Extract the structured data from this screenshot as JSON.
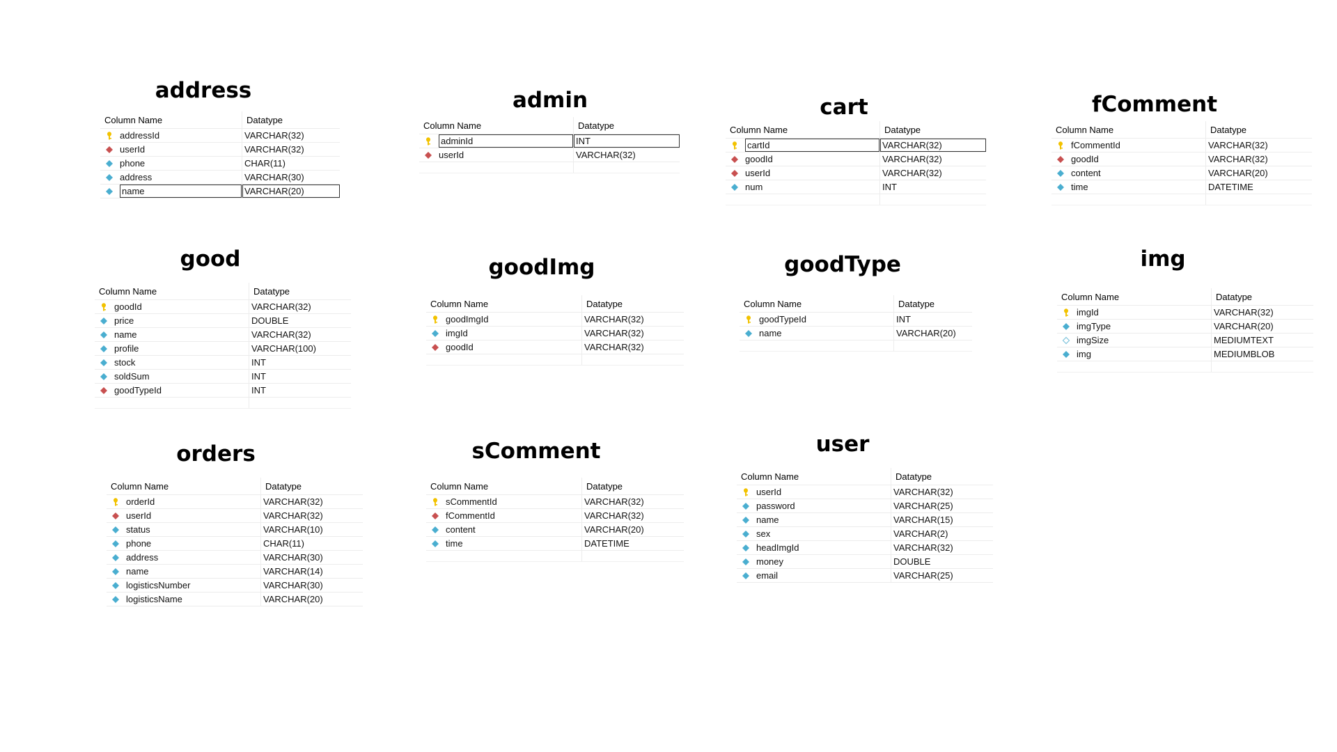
{
  "header": {
    "col_name": "Column Name",
    "col_type": "Datatype"
  },
  "colors": {
    "pk": "#f2c200",
    "fk": "#c85050",
    "col": "#4aaed0",
    "colOutline": "#7fc4dc"
  },
  "tables": [
    {
      "name": "address",
      "columns": [
        {
          "name": "addressId",
          "type": "VARCHAR(32)",
          "key": "pk"
        },
        {
          "name": "userId",
          "type": "VARCHAR(32)",
          "key": "fk"
        },
        {
          "name": "phone",
          "type": "CHAR(11)",
          "key": "col"
        },
        {
          "name": "address",
          "type": "VARCHAR(30)",
          "key": "col"
        },
        {
          "name": "name",
          "type": "VARCHAR(20)",
          "key": "col",
          "selected": true
        }
      ]
    },
    {
      "name": "admin",
      "columns": [
        {
          "name": "adminId",
          "type": "INT",
          "key": "pk",
          "selected": true
        },
        {
          "name": "userId",
          "type": "VARCHAR(32)",
          "key": "fk"
        }
      ]
    },
    {
      "name": "cart",
      "columns": [
        {
          "name": "cartId",
          "type": "VARCHAR(32)",
          "key": "pk",
          "selected": true
        },
        {
          "name": "goodId",
          "type": "VARCHAR(32)",
          "key": "fk"
        },
        {
          "name": "userId",
          "type": "VARCHAR(32)",
          "key": "fk"
        },
        {
          "name": "num",
          "type": "INT",
          "key": "col"
        }
      ]
    },
    {
      "name": "fComment",
      "columns": [
        {
          "name": "fCommentId",
          "type": "VARCHAR(32)",
          "key": "pk"
        },
        {
          "name": "goodId",
          "type": "VARCHAR(32)",
          "key": "fk"
        },
        {
          "name": "content",
          "type": "VARCHAR(20)",
          "key": "col"
        },
        {
          "name": "time",
          "type": "DATETIME",
          "key": "col"
        }
      ]
    },
    {
      "name": "good",
      "columns": [
        {
          "name": "goodId",
          "type": "VARCHAR(32)",
          "key": "pk"
        },
        {
          "name": "price",
          "type": "DOUBLE",
          "key": "col"
        },
        {
          "name": "name",
          "type": "VARCHAR(32)",
          "key": "col"
        },
        {
          "name": "profile",
          "type": "VARCHAR(100)",
          "key": "col"
        },
        {
          "name": "stock",
          "type": "INT",
          "key": "col"
        },
        {
          "name": "soldSum",
          "type": "INT",
          "key": "col"
        },
        {
          "name": "goodTypeId",
          "type": "INT",
          "key": "fk"
        }
      ]
    },
    {
      "name": "goodImg",
      "columns": [
        {
          "name": "goodImgId",
          "type": "VARCHAR(32)",
          "key": "pk"
        },
        {
          "name": "imgId",
          "type": "VARCHAR(32)",
          "key": "col"
        },
        {
          "name": "goodId",
          "type": "VARCHAR(32)",
          "key": "fk"
        }
      ]
    },
    {
      "name": "goodType",
      "columns": [
        {
          "name": "goodTypeId",
          "type": "INT",
          "key": "pk"
        },
        {
          "name": "name",
          "type": "VARCHAR(20)",
          "key": "col"
        }
      ]
    },
    {
      "name": "img",
      "columns": [
        {
          "name": "imgId",
          "type": "VARCHAR(32)",
          "key": "pk"
        },
        {
          "name": "imgType",
          "type": "VARCHAR(20)",
          "key": "col"
        },
        {
          "name": "imgSize",
          "type": "MEDIUMTEXT",
          "key": "colOutline"
        },
        {
          "name": "img",
          "type": "MEDIUMBLOB",
          "key": "col"
        }
      ]
    },
    {
      "name": "orders",
      "columns": [
        {
          "name": "orderId",
          "type": "VARCHAR(32)",
          "key": "pk"
        },
        {
          "name": "userId",
          "type": "VARCHAR(32)",
          "key": "fk"
        },
        {
          "name": "status",
          "type": "VARCHAR(10)",
          "key": "col"
        },
        {
          "name": "phone",
          "type": "CHAR(11)",
          "key": "col"
        },
        {
          "name": "address",
          "type": "VARCHAR(30)",
          "key": "col"
        },
        {
          "name": "name",
          "type": "VARCHAR(14)",
          "key": "col"
        },
        {
          "name": "logisticsNumber",
          "type": "VARCHAR(30)",
          "key": "col"
        },
        {
          "name": "logisticsName",
          "type": "VARCHAR(20)",
          "key": "col"
        }
      ]
    },
    {
      "name": "sComment",
      "columns": [
        {
          "name": "sCommentId",
          "type": "VARCHAR(32)",
          "key": "pk"
        },
        {
          "name": "fCommentId",
          "type": "VARCHAR(32)",
          "key": "fk"
        },
        {
          "name": "content",
          "type": "VARCHAR(20)",
          "key": "col"
        },
        {
          "name": "time",
          "type": "DATETIME",
          "key": "col"
        }
      ]
    },
    {
      "name": "user",
      "columns": [
        {
          "name": "userId",
          "type": "VARCHAR(32)",
          "key": "pk"
        },
        {
          "name": "password",
          "type": "VARCHAR(25)",
          "key": "col"
        },
        {
          "name": "name",
          "type": "VARCHAR(15)",
          "key": "col"
        },
        {
          "name": "sex",
          "type": "VARCHAR(2)",
          "key": "col"
        },
        {
          "name": "headImgId",
          "type": "VARCHAR(32)",
          "key": "col"
        },
        {
          "name": "money",
          "type": "DOUBLE",
          "key": "col"
        },
        {
          "name": "email",
          "type": "VARCHAR(25)",
          "key": "col"
        }
      ]
    }
  ]
}
